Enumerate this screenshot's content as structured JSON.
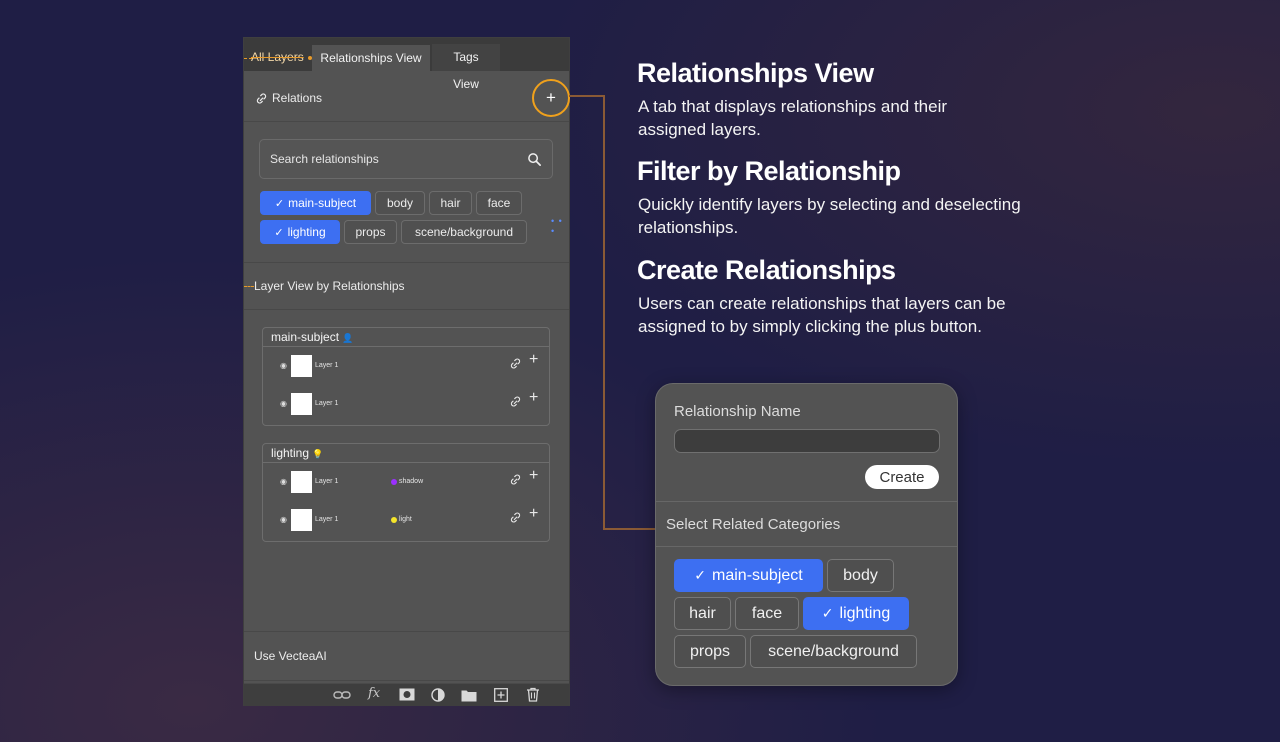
{
  "panel": {
    "tabs": [
      {
        "label": "All Layers"
      },
      {
        "label": "Relationships View"
      },
      {
        "label": "Tags View"
      }
    ],
    "relations_label": "Relations",
    "add_symbol": "+",
    "search_placeholder": "Search relationships",
    "filter_chips": [
      {
        "label": "main-subject",
        "selected": true
      },
      {
        "label": "body",
        "selected": false
      },
      {
        "label": "hair",
        "selected": false
      },
      {
        "label": "face",
        "selected": false
      },
      {
        "label": "lighting",
        "selected": true
      },
      {
        "label": "props",
        "selected": false
      },
      {
        "label": "scene/background",
        "selected": false
      }
    ],
    "layer_view_title": "Layer View by Relationships",
    "groups": [
      {
        "title": "main-subject",
        "emoji": "👤",
        "layers": [
          {
            "name": "Layer 1",
            "tag": "",
            "tag_color": ""
          },
          {
            "name": "Layer 1",
            "tag": "",
            "tag_color": ""
          }
        ]
      },
      {
        "title": "lighting",
        "emoji": "💡",
        "layers": [
          {
            "name": "Layer 1",
            "tag": "shadow",
            "tag_color": "#9b30ff"
          },
          {
            "name": "Layer 1",
            "tag": "light",
            "tag_color": "#f5e52a"
          }
        ]
      }
    ],
    "use_ai_label": "Use VecteaAI",
    "toolbar_icons": [
      "link-icon",
      "fx-icon",
      "mask-icon",
      "adjustment-icon",
      "folder-icon",
      "new-layer-icon",
      "trash-icon"
    ],
    "fx_label": "fx"
  },
  "descriptions": [
    {
      "title": "Relationships View",
      "body": "A tab that displays relationships and their assigned layers."
    },
    {
      "title": "Filter by Relationship",
      "body": "Quickly identify layers by selecting and deselecting relationships."
    },
    {
      "title": "Create Relationships",
      "body": "Users can create relationships that layers can be assigned to by simply clicking the plus button."
    }
  ],
  "dialog": {
    "name_label": "Relationship Name",
    "name_value": "",
    "create_label": "Create",
    "categories_label": "Select Related Categories",
    "chips": [
      {
        "label": "main-subject",
        "selected": true
      },
      {
        "label": "body",
        "selected": false
      },
      {
        "label": "hair",
        "selected": false
      },
      {
        "label": "face",
        "selected": false
      },
      {
        "label": "lighting",
        "selected": true
      },
      {
        "label": "props",
        "selected": false
      },
      {
        "label": "scene/background",
        "selected": false
      }
    ]
  },
  "colors": {
    "accent": "#3d6ff2",
    "highlight_ring": "#f0a11c",
    "background": "#1f1e45",
    "panel": "#535353"
  }
}
